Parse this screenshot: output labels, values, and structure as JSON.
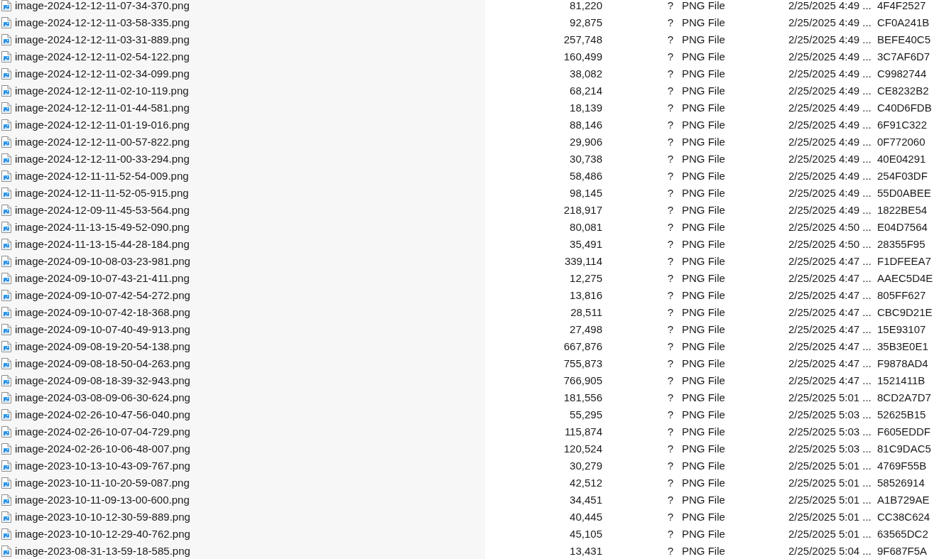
{
  "file_list": {
    "rows": [
      {
        "name": "image-2024-12-12-11-07-34-370.png",
        "size": "81,220",
        "column_3": "?",
        "type": "PNG File",
        "date": "2/25/2025 4:49 ...",
        "column_6": "4F4F2527"
      },
      {
        "name": "image-2024-12-12-11-03-58-335.png",
        "size": "92,875",
        "column_3": "?",
        "type": "PNG File",
        "date": "2/25/2025 4:49 ...",
        "column_6": "CF0A241B"
      },
      {
        "name": "image-2024-12-12-11-03-31-889.png",
        "size": "257,748",
        "column_3": "?",
        "type": "PNG File",
        "date": "2/25/2025 4:49 ...",
        "column_6": "BEFE40C5"
      },
      {
        "name": "image-2024-12-12-11-02-54-122.png",
        "size": "160,499",
        "column_3": "?",
        "type": "PNG File",
        "date": "2/25/2025 4:49 ...",
        "column_6": "3C7AF6D7"
      },
      {
        "name": "image-2024-12-12-11-02-34-099.png",
        "size": "38,082",
        "column_3": "?",
        "type": "PNG File",
        "date": "2/25/2025 4:49 ...",
        "column_6": "C9982744"
      },
      {
        "name": "image-2024-12-12-11-02-10-119.png",
        "size": "68,214",
        "column_3": "?",
        "type": "PNG File",
        "date": "2/25/2025 4:49 ...",
        "column_6": "CE8232B2"
      },
      {
        "name": "image-2024-12-12-11-01-44-581.png",
        "size": "18,139",
        "column_3": "?",
        "type": "PNG File",
        "date": "2/25/2025 4:49 ...",
        "column_6": "C40D6FDB"
      },
      {
        "name": "image-2024-12-12-11-01-19-016.png",
        "size": "88,146",
        "column_3": "?",
        "type": "PNG File",
        "date": "2/25/2025 4:49 ...",
        "column_6": "6F91C322"
      },
      {
        "name": "image-2024-12-12-11-00-57-822.png",
        "size": "29,906",
        "column_3": "?",
        "type": "PNG File",
        "date": "2/25/2025 4:49 ...",
        "column_6": "0F772060"
      },
      {
        "name": "image-2024-12-12-11-00-33-294.png",
        "size": "30,738",
        "column_3": "?",
        "type": "PNG File",
        "date": "2/25/2025 4:49 ...",
        "column_6": "40E04291"
      },
      {
        "name": "image-2024-12-11-11-52-54-009.png",
        "size": "58,486",
        "column_3": "?",
        "type": "PNG File",
        "date": "2/25/2025 4:49 ...",
        "column_6": "254F03DF"
      },
      {
        "name": "image-2024-12-11-11-52-05-915.png",
        "size": "98,145",
        "column_3": "?",
        "type": "PNG File",
        "date": "2/25/2025 4:49 ...",
        "column_6": "55D0ABEE"
      },
      {
        "name": "image-2024-12-09-11-45-53-564.png",
        "size": "218,917",
        "column_3": "?",
        "type": "PNG File",
        "date": "2/25/2025 4:49 ...",
        "column_6": "1822BE54"
      },
      {
        "name": "image-2024-11-13-15-49-52-090.png",
        "size": "80,081",
        "column_3": "?",
        "type": "PNG File",
        "date": "2/25/2025 4:50 ...",
        "column_6": "E04D7564"
      },
      {
        "name": "image-2024-11-13-15-44-28-184.png",
        "size": "35,491",
        "column_3": "?",
        "type": "PNG File",
        "date": "2/25/2025 4:50 ...",
        "column_6": "28355F95"
      },
      {
        "name": "image-2024-09-10-08-03-23-981.png",
        "size": "339,114",
        "column_3": "?",
        "type": "PNG File",
        "date": "2/25/2025 4:47 ...",
        "column_6": "F1DFEEA7"
      },
      {
        "name": "image-2024-09-10-07-43-21-411.png",
        "size": "12,275",
        "column_3": "?",
        "type": "PNG File",
        "date": "2/25/2025 4:47 ...",
        "column_6": "AAEC5D4E"
      },
      {
        "name": "image-2024-09-10-07-42-54-272.png",
        "size": "13,816",
        "column_3": "?",
        "type": "PNG File",
        "date": "2/25/2025 4:47 ...",
        "column_6": "805FF627"
      },
      {
        "name": "image-2024-09-10-07-42-18-368.png",
        "size": "28,511",
        "column_3": "?",
        "type": "PNG File",
        "date": "2/25/2025 4:47 ...",
        "column_6": "CBC9D21E"
      },
      {
        "name": "image-2024-09-10-07-40-49-913.png",
        "size": "27,498",
        "column_3": "?",
        "type": "PNG File",
        "date": "2/25/2025 4:47 ...",
        "column_6": "15E93107"
      },
      {
        "name": "image-2024-09-08-19-20-54-138.png",
        "size": "667,876",
        "column_3": "?",
        "type": "PNG File",
        "date": "2/25/2025 4:47 ...",
        "column_6": "35B3E0E1"
      },
      {
        "name": "image-2024-09-08-18-50-04-263.png",
        "size": "755,873",
        "column_3": "?",
        "type": "PNG File",
        "date": "2/25/2025 4:47 ...",
        "column_6": "F9878AD4"
      },
      {
        "name": "image-2024-09-08-18-39-32-943.png",
        "size": "766,905",
        "column_3": "?",
        "type": "PNG File",
        "date": "2/25/2025 4:47 ...",
        "column_6": "1521411B"
      },
      {
        "name": "image-2024-03-08-09-06-30-624.png",
        "size": "181,556",
        "column_3": "?",
        "type": "PNG File",
        "date": "2/25/2025 5:01 ...",
        "column_6": "8CD2A7D7"
      },
      {
        "name": "image-2024-02-26-10-47-56-040.png",
        "size": "55,295",
        "column_3": "?",
        "type": "PNG File",
        "date": "2/25/2025 5:03 ...",
        "column_6": "52625B15"
      },
      {
        "name": "image-2024-02-26-10-07-04-729.png",
        "size": "115,874",
        "column_3": "?",
        "type": "PNG File",
        "date": "2/25/2025 5:03 ...",
        "column_6": "F605EDDF"
      },
      {
        "name": "image-2024-02-26-10-06-48-007.png",
        "size": "120,524",
        "column_3": "?",
        "type": "PNG File",
        "date": "2/25/2025 5:03 ...",
        "column_6": "81C9DAC5"
      },
      {
        "name": "image-2023-10-13-10-43-09-767.png",
        "size": "30,279",
        "column_3": "?",
        "type": "PNG File",
        "date": "2/25/2025 5:01 ...",
        "column_6": "4769F55B"
      },
      {
        "name": "image-2023-10-11-10-20-59-087.png",
        "size": "42,512",
        "column_3": "?",
        "type": "PNG File",
        "date": "2/25/2025 5:01 ...",
        "column_6": "58526914"
      },
      {
        "name": "image-2023-10-11-09-13-00-600.png",
        "size": "34,451",
        "column_3": "?",
        "type": "PNG File",
        "date": "2/25/2025 5:01 ...",
        "column_6": "A1B729AE"
      },
      {
        "name": "image-2023-10-10-12-30-59-889.png",
        "size": "40,445",
        "column_3": "?",
        "type": "PNG File",
        "date": "2/25/2025 5:01 ...",
        "column_6": "CC38C624"
      },
      {
        "name": "image-2023-10-10-12-29-40-762.png",
        "size": "45,105",
        "column_3": "?",
        "type": "PNG File",
        "date": "2/25/2025 5:01 ...",
        "column_6": "63565DC2"
      },
      {
        "name": "image-2023-08-31-13-59-18-585.png",
        "size": "13,431",
        "column_3": "?",
        "type": "PNG File",
        "date": "2/25/2025 5:04 ...",
        "column_6": "9F687F5A"
      }
    ]
  }
}
